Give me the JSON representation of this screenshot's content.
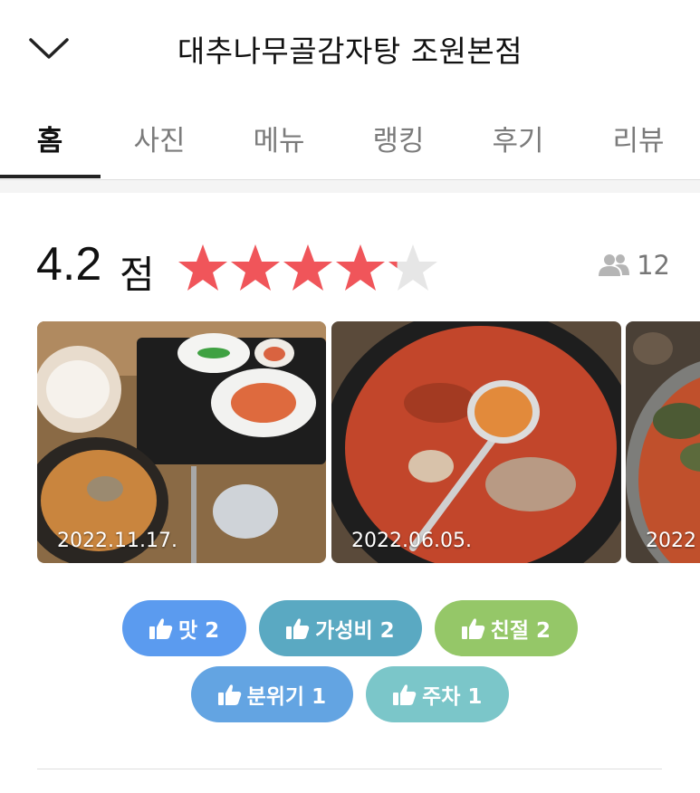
{
  "header": {
    "title": "대추나무골감자탕 조원본점",
    "back_icon": "chevron-down-icon"
  },
  "tabs": [
    {
      "label": "홈",
      "active": true
    },
    {
      "label": "사진",
      "active": false
    },
    {
      "label": "메뉴",
      "active": false
    },
    {
      "label": "랭킹",
      "active": false
    },
    {
      "label": "후기",
      "active": false
    },
    {
      "label": "리뷰",
      "active": false
    }
  ],
  "rating": {
    "score": "4.2",
    "unit": "점",
    "stars_value": 4.2,
    "stars_max": 5,
    "star_color": "#f0555a",
    "star_empty_color": "#e6e6e6",
    "people_icon": "people-icon",
    "people_count": "12"
  },
  "photos": [
    {
      "date": "2022.11.17."
    },
    {
      "date": "2022.06.05."
    },
    {
      "date": "2022"
    }
  ],
  "tags": [
    {
      "label": "맛 2",
      "color": "#5b9bef",
      "icon": "thumbs-up-icon"
    },
    {
      "label": "가성비 2",
      "color": "#5aa9c2",
      "icon": "thumbs-up-icon"
    },
    {
      "label": "친절 2",
      "color": "#95c768",
      "icon": "thumbs-up-icon"
    },
    {
      "label": "분위기 1",
      "color": "#63a4e2",
      "icon": "thumbs-up-icon"
    },
    {
      "label": "주차 1",
      "color": "#7bc6c9",
      "icon": "thumbs-up-icon"
    }
  ]
}
